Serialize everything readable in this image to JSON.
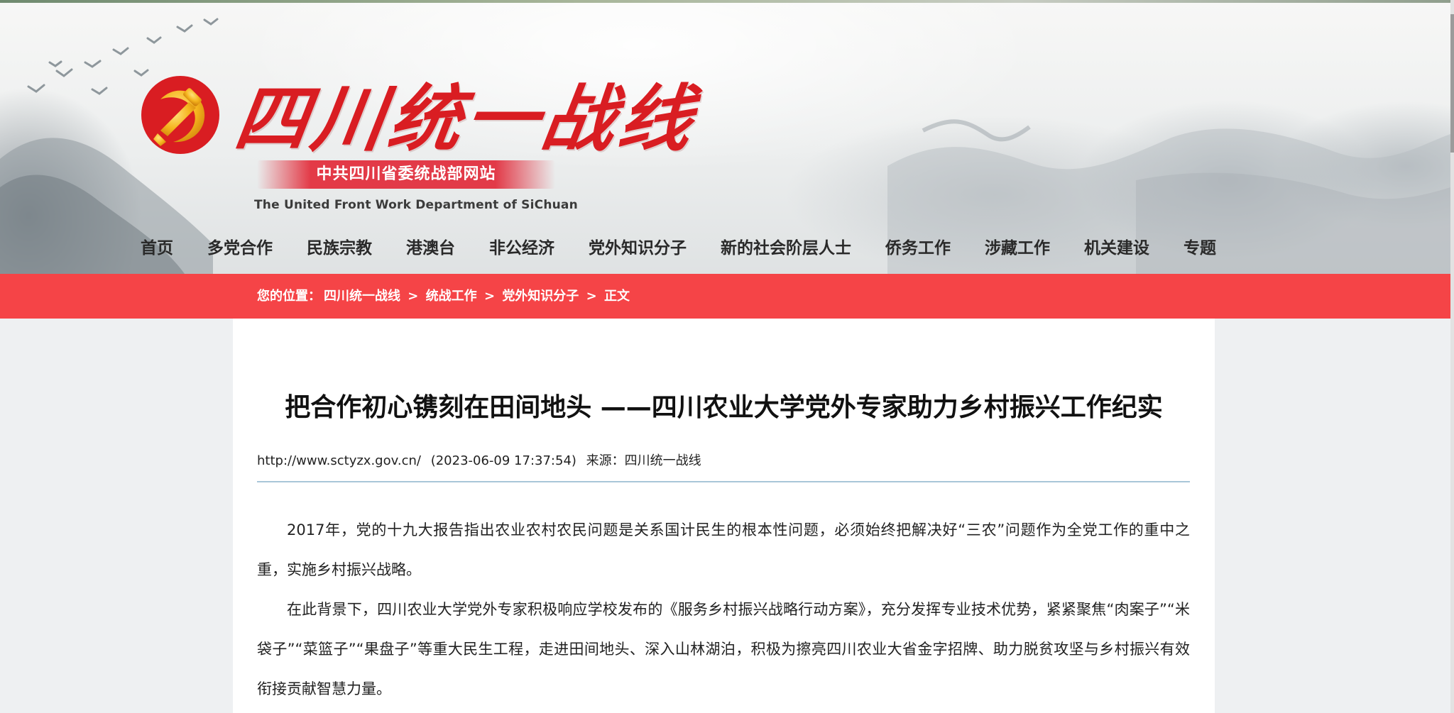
{
  "site": {
    "title": "四川统一战线",
    "subtitle": "中共四川省委统战部网站",
    "english": "The United Front Work Department of SiChuan",
    "emblem_icon": "party-emblem-icon",
    "colors": {
      "brand_red": "#d91d22",
      "breadcrumb_bar": "#f54447",
      "emblem_gold": "#f5b51e"
    }
  },
  "nav": {
    "items": [
      {
        "label": "首页"
      },
      {
        "label": "多党合作"
      },
      {
        "label": "民族宗教"
      },
      {
        "label": "港澳台"
      },
      {
        "label": "非公经济"
      },
      {
        "label": "党外知识分子"
      },
      {
        "label": "新的社会阶层人士"
      },
      {
        "label": "侨务工作"
      },
      {
        "label": "涉藏工作"
      },
      {
        "label": "机关建设"
      },
      {
        "label": "专题"
      }
    ]
  },
  "breadcrumb": {
    "prefix": "您的位置：",
    "items": [
      "四川统一战线",
      "统战工作",
      "党外知识分子",
      "正文"
    ],
    "separator": ">"
  },
  "article": {
    "title": "把合作初心镌刻在田间地头 ——四川农业大学党外专家助力乡村振兴工作纪实",
    "meta": {
      "url": "http://www.sctyzx.gov.cn/",
      "datetime": "(2023-06-09 17:37:54)",
      "source_label": "来源：",
      "source": "四川统一战线"
    },
    "paragraphs": [
      "2017年，党的十九大报告指出农业农村农民问题是关系国计民生的根本性问题，必须始终把解决好“三农”问题作为全党工作的重中之重，实施乡村振兴战略。",
      "在此背景下，四川农业大学党外专家积极响应学校发布的《服务乡村振兴战略行动方案》，充分发挥专业技术优势，紧紧聚焦“肉案子”“米袋子”“菜篮子”“果盘子”等重大民生工程，走进田间地头、深入山林湖泊，积极为擦亮四川农业大省金字招牌、助力脱贫攻坚与乡村振兴有效衔接贡献智慧力量。"
    ]
  }
}
